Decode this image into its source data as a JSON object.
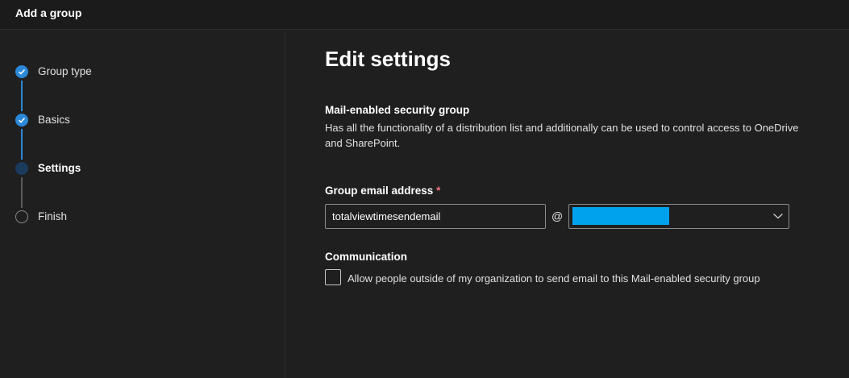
{
  "header": {
    "title": "Add a group"
  },
  "wizard": {
    "steps": [
      {
        "label": "Group type",
        "state": "done"
      },
      {
        "label": "Basics",
        "state": "done"
      },
      {
        "label": "Settings",
        "state": "current"
      },
      {
        "label": "Finish",
        "state": "todo"
      }
    ]
  },
  "main": {
    "title": "Edit settings",
    "group_kind_heading": "Mail-enabled security group",
    "group_kind_description": "Has all the functionality of a distribution list and additionally can be used to control access to OneDrive and SharePoint.",
    "email": {
      "label": "Group email address",
      "required_marker": "*",
      "value": "totalviewtimesendemail",
      "at": "@"
    },
    "communication": {
      "heading": "Communication",
      "checkbox_label": "Allow people outside of my organization to send email to this Mail-enabled security group",
      "checked": false
    }
  },
  "colors": {
    "accent": "#2b88d8",
    "background": "#1f1f1f",
    "required": "#f1707b"
  }
}
